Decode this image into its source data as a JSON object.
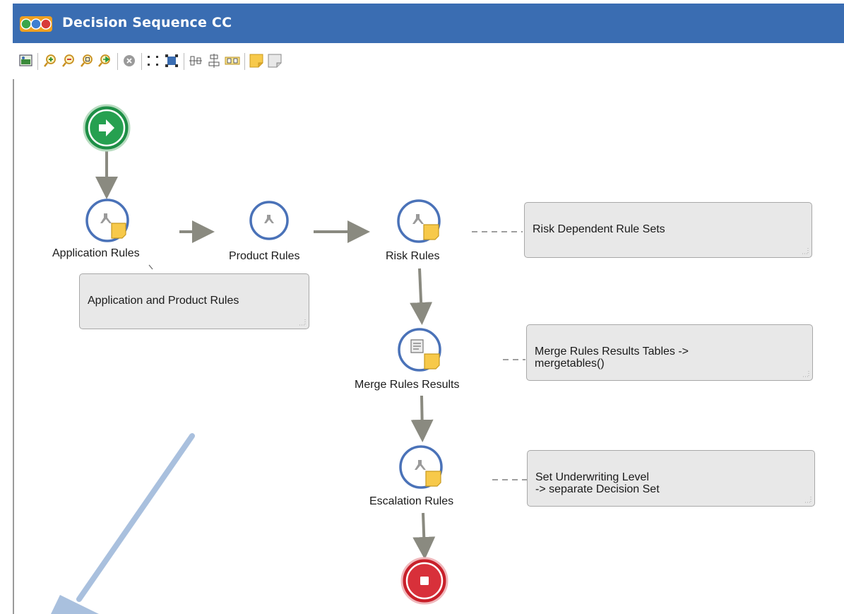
{
  "window": {
    "title": "Decision Sequence CC"
  },
  "toolbar": {
    "buttons": [
      "image-icon",
      "zoom-in-icon",
      "zoom-out-icon",
      "zoom-fit-icon",
      "zoom-apply-icon",
      "stop-icon",
      "select-nodes-icon",
      "select-all-icon",
      "align-vertical-icon",
      "align-horizontal-icon",
      "distribute-icon",
      "note-icon",
      "note-grey-icon"
    ]
  },
  "nodes": {
    "start": {
      "label": "",
      "icon": "arrow-right-icon"
    },
    "application_rules": {
      "label": "Application Rules"
    },
    "product_rules": {
      "label": "Product Rules"
    },
    "risk_rules": {
      "label": "Risk Rules"
    },
    "merge_rules_results": {
      "label": "Merge Rules Results"
    },
    "escalation_rules": {
      "label": "Escalation Rules"
    },
    "end": {
      "label": "",
      "icon": "stop-square-icon"
    }
  },
  "notes": {
    "application_product": "Application and Product Rules",
    "risk_dependent": "Risk Dependent Rule Sets",
    "merge_tables": "Merge Rules Results Tables ->\nmergetables()",
    "underwriting": "Set Underwriting Level\n-> separate Decision Set"
  },
  "colors": {
    "title_bar": "#3a6db2",
    "node_ring": "#4a72b8",
    "start_green": "#1e8f46",
    "end_red": "#c8202a",
    "connector": "#8a8a80",
    "annotation_arrow": "#a9c0de",
    "note_fill": "#e8e8e8"
  }
}
